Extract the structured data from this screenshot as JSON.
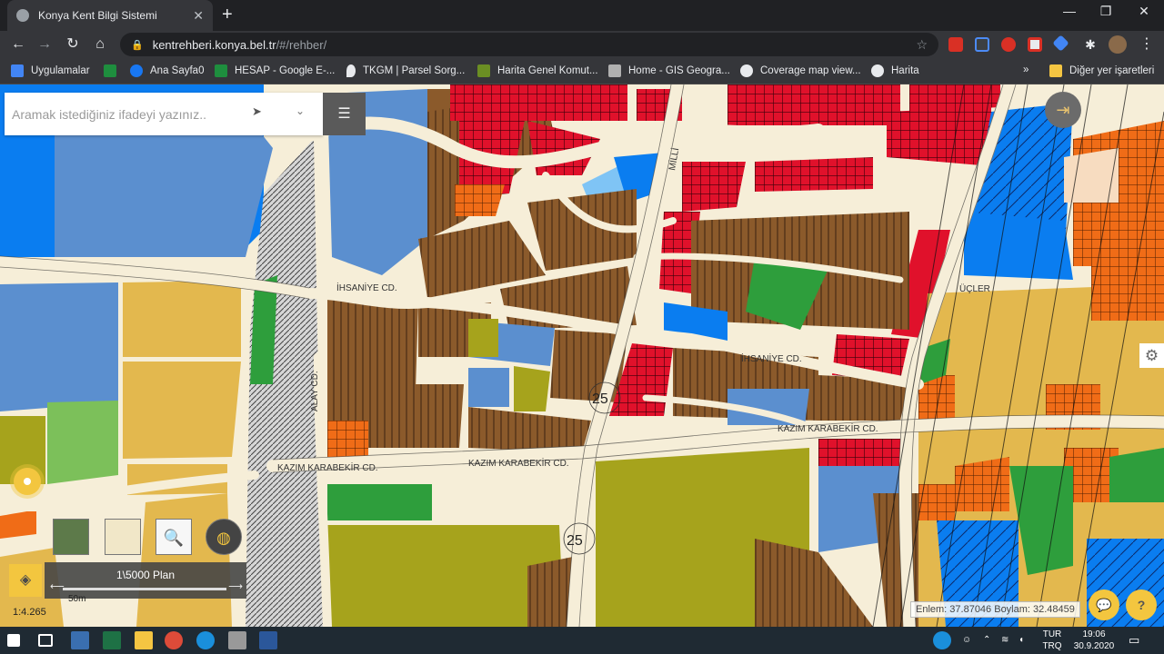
{
  "browser": {
    "tab_title": "Konya Kent Bilgi Sistemi",
    "url_host": "kentrehberi.konya.bel.tr",
    "url_path": "/#/rehber/"
  },
  "bookmarks": [
    {
      "label": "Uygulamalar",
      "icon_color": "#4285f4"
    },
    {
      "label": "",
      "icon_color": "#1e8e3e"
    },
    {
      "label": "Ana Sayfa0",
      "icon_color": "#1877f2"
    },
    {
      "label": "HESAP - Google E-...",
      "icon_color": "#1e8e3e"
    },
    {
      "label": "TKGM | Parsel Sorg...",
      "icon_color": "#e8eaed"
    },
    {
      "label": "Harita Genel Komut...",
      "icon_color": "#6b8e23"
    },
    {
      "label": "Home - GIS Geogra...",
      "icon_color": "#b0b0b0"
    },
    {
      "label": "Coverage map view...",
      "icon_color": "#e8eaed"
    },
    {
      "label": "Harita",
      "icon_color": "#e8eaed"
    },
    {
      "label": "Diğer yer işaretleri",
      "icon_color": "#f4c542"
    }
  ],
  "map": {
    "search_placeholder": "Aramak istediğiniz ifadeyi yazınız..",
    "layer_name": "1\\5000 Plan",
    "scale_text": "1:4.265",
    "scale_bar_label": "50m",
    "coords_text": "Enlem: 37.87046 Boylam: 32.48459",
    "street_labels": [
      "İHSANİYE CD.",
      "İHSANİYE CD.",
      "KAZIM KARABEKİR CD.",
      "KAZIM KARABEKİR CD.",
      "KAZIM KARABEKİR CD.",
      "ALAY CD.",
      "MİLLİ",
      "ÜÇLER"
    ],
    "height_labels": [
      "25",
      "25"
    ],
    "colors": {
      "residential": "#8b5a2b",
      "commercial": "#e0112b",
      "park": "#2e9e3c",
      "public": "#5b8fcf",
      "school": "#0a7df0",
      "yellow": "#e3b84e",
      "olive": "#a6a31c",
      "road": "#f6eed8"
    }
  },
  "taskbar": {
    "lang_top": "TUR",
    "lang_bottom": "TRQ",
    "time": "19:06",
    "date": "30.9.2020"
  }
}
